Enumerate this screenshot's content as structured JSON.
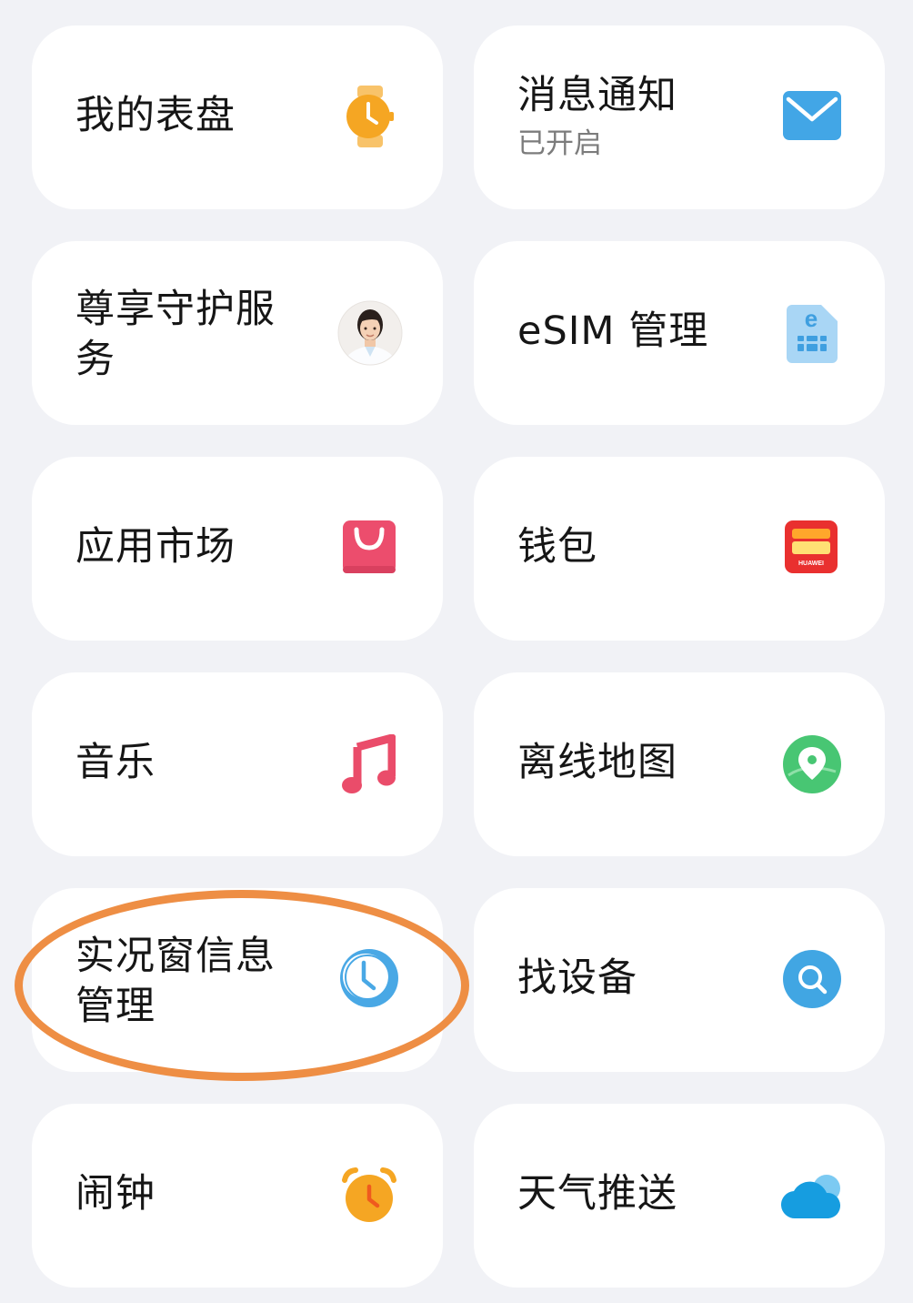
{
  "cards": {
    "watch_faces": {
      "label": "我的表盘",
      "icon": "watch-icon"
    },
    "notifications": {
      "label": "消息通知",
      "status": "已开启",
      "icon": "mail-icon"
    },
    "guardian_service": {
      "label": "尊享守护服务",
      "icon": "doctor-avatar"
    },
    "esim": {
      "label": "eSIM 管理",
      "icon": "esim-card-icon"
    },
    "app_market": {
      "label": "应用市场",
      "icon": "shopping-bag-icon"
    },
    "wallet": {
      "label": "钱包",
      "icon": "wallet-icon",
      "icon_text": "HUAWEI"
    },
    "music": {
      "label": "音乐",
      "icon": "music-note-icon"
    },
    "offline_map": {
      "label": "离线地图",
      "icon": "map-pin-icon"
    },
    "live_window": {
      "label": "实况窗信息管理",
      "icon": "clock-icon"
    },
    "find_device": {
      "label": "找设备",
      "icon": "search-icon"
    },
    "alarm": {
      "label": "闹钟",
      "icon": "alarm-clock-icon"
    },
    "weather_push": {
      "label": "天气推送",
      "icon": "cloud-icon"
    }
  },
  "colors": {
    "page_bg": "#f1f2f6",
    "card_bg": "#ffffff",
    "annotation": "#ee8e44"
  }
}
